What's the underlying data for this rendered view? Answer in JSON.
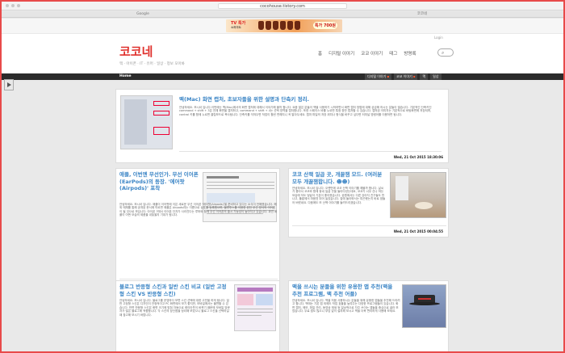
{
  "browser": {
    "url": "cocohouse.tistory.com",
    "tabs": [
      "Google",
      "코코네"
    ]
  },
  "ad": {
    "brand": "TV 특가",
    "product": "쇼퍼마트",
    "price": "특가 700원"
  },
  "blog": {
    "title": "코코네",
    "tagline": "맥 · 아이폰 · IT · 유머 · 일상 · 정보 모아봐",
    "toplinks": [
      "Login"
    ],
    "nav": [
      "홈",
      "디지털 이야기",
      "코코 이야기",
      "태그",
      "방명록"
    ],
    "home_label": "Home",
    "categories": [
      "디지털 이야기",
      "코코 이야기",
      "맥",
      "일상"
    ]
  },
  "posts": [
    {
      "title": "맥(Mac) 화면 캡처, 초보자들을 위한 설명과 단축키 정리.",
      "body": "안녕하세요. 보시셔 입니다.이번에는 맥(Mac)에서의 화면 캡처에 대해서 이야기해 볼까 합니다. 요즘 많은 분들이 맥을 사용하기 시작하면서 화면 캡처 방법에 대해 궁금해 하시는 분들이 많습니다. 기본적인 단축키인 command + shift + 3은 전체 화면을 캡처하고, command + shift + 4는 선택 영역을 캡처합니다. 또한 스페이스 바를 누르면 특정 창만 캡처할 수 있습니다. 캡처된 이미지는 기본적으로 바탕화면에 저장되며, control 키를 함께 누르면 클립보드로 복사됩니다. 단축키를 익혀두면 작업이 훨씬 편해지니 꼭 알아두세요. 캡처 파일의 저장 위치나 형식을 바꾸고 싶다면 터미널 명령어를 이용하면 됩니다.",
      "date": "Wed, 21 Oct 2015 18:30:06"
    },
    {
      "title": "애플, 이번엔 무선인가. 무선 이어폰(EarPods)의 등장. '에어팟(Airpods)' 포착",
      "body": "안녕하세요. 보시셔 입니다. 애플이 이어팟에 이은 새로운 무선 이어폰 '에어팟(Airpods)'을 준비하고 있다는 소식이 전해졌습니다. 해외 매체를 통해 공개된 문서에 따르면 애플은 Airpods라는 이름으로 상표를 등록했으며, 블루투스를 이용한 완전 무선 방식의 이어폰이 될 것으로 보입니다. 아이폰 7에서 이어폰 단자가 사라진다는 루머와 함께 무선 이어폰의 출시 가능성이 높아지고 있습니다. 과연 애플이 어떤 모습의 제품을 내놓을지 기대가 됩니다.",
      "date": "Wed, 21 Oct 2015 09:29:38"
    },
    {
      "title": "코코 산책 일곱 곳, 개꿀잼 모드. (여러분 모두 개꿀잼합니다. ☻☻)",
      "body": "안녕하세요. 보시셔 입니다. 오랜만에 코코 산책 이야기를 해볼까 합니다. 날씨가 좋아서 코코와 함께 동네 일곱 곳을 돌아다녔는데요, 코코가 너무 신나 하는 모습에 저도 덩달아 기분이 좋아졌습니다. 공원에서는 다른 강아지 친구들도 만나고, 풀밭에서 마음껏 뛰어 놀았습니다. 집에 돌아와서는 피곤했는지 바로 잠들어 버렸네요. 다음에도 또 산책 이야기를 들려드리겠습니다.",
      "date": "Wed, 21 Oct 2015 00:04:55"
    },
    {
      "title": "블로그 반응형 스킨과 일반 스킨 비교 (일반 고정형 스킨 VS 반응형 스킨)",
      "body": "안녕하세요. 보시셔 입니다. 블로그를 운영하다 보면 스킨 선택에 대한 고민을 하게 됩니다. 일반 고정형 스킨은 디자인이 안정적이고 PC 화면에서 보기 좋지만, 모바일에서는 불편할 수 있습니다. 반면 반응형 스킨은 화면 크기에 맞춰 자동으로 레이아웃이 바뀌기 때문에 모바일 방문자가 많은 블로그에 적합합니다. 각 스킨의 장단점을 정리해 보았으니 블로그 스킨을 선택하실 때 참고해 보시기 바랍니다.",
      "date": ""
    },
    {
      "title": "맥을 쓰시는 분들을 위한 유용한 앱 추천(맥을 추천 프로그램, 맥 추천 어플)",
      "body": "안녕하세요. 보시셔 입니다. 맥을 처음 사용하시는 분들을 위해 유용한 앱들을 추천해 드리려고 합니다. 맥에는 기본 앱 외에도 작업 효율을 높여주는 다양한 프로그램들이 있습니다. 화면 캡처, 메모, 파일 관리, 동영상 재생 등 일상적으로 자주 쓰이는 앱들을 중심으로 골라 보았습니다. 무료 앱도 많으니 부담 없이 설치해 보시고 맥을 더욱 편리하게 사용해 보세요.",
      "date": ""
    }
  ],
  "colors": {
    "accent_red": "#e0312d",
    "title_blue": "#3a84c5",
    "dark_bar": "#2b2b2b",
    "frame_border": "#e84a4a"
  }
}
